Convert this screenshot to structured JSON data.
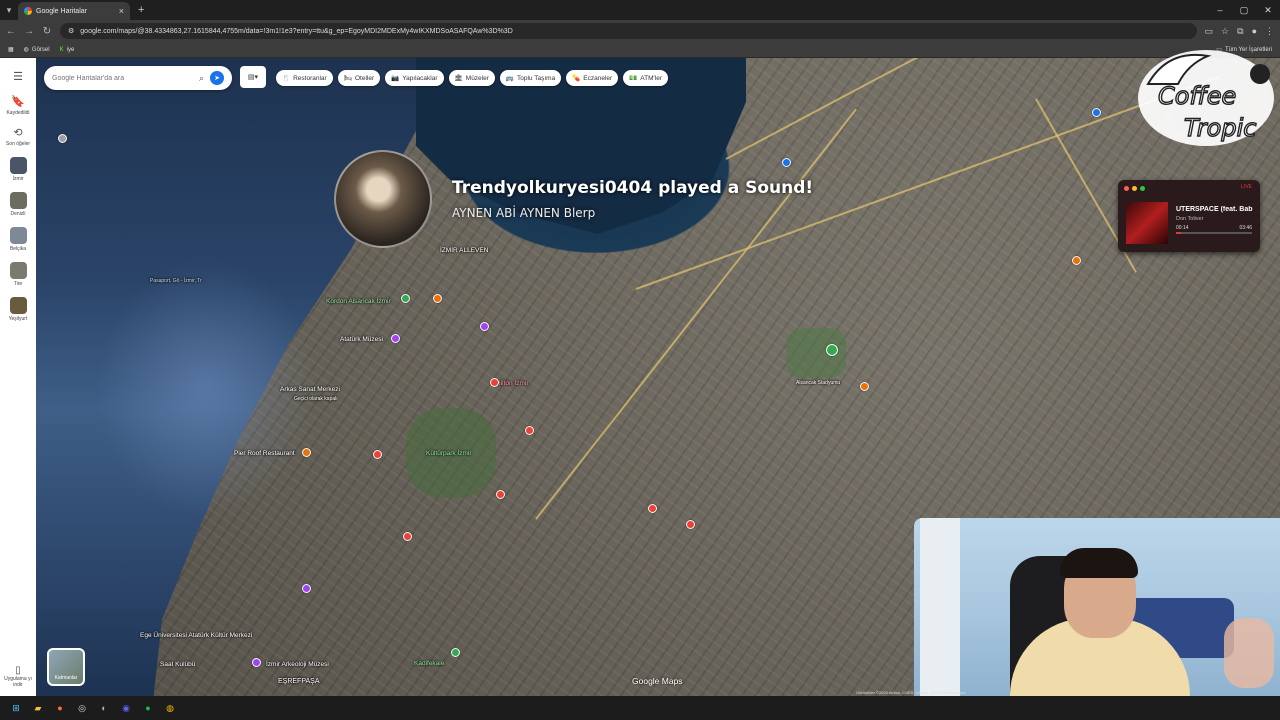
{
  "browser": {
    "tab_title": "Google Haritalar",
    "tab_close": "×",
    "new_tab": "+",
    "url": "google.com/maps/@38.4334863,27.1615844,4755m/data=!3m1!1e3?entry=ttu&g_ep=EgoyMDI2MDExMy4wIKXMDSoASAFQAw%3D%3D",
    "bookmarks": [
      {
        "label": "Görsel"
      },
      {
        "label": "iye"
      }
    ],
    "bookmarks_right": "Tüm Yer İşaretleri"
  },
  "rail": {
    "menu": "☰",
    "items": [
      {
        "label": "Kaydedildi",
        "icon": "bookmark-icon"
      },
      {
        "label": "Son öğeler",
        "icon": "history-icon"
      },
      {
        "label": "İzmir",
        "icon": "place-thumb"
      },
      {
        "label": "Denizli",
        "icon": "place-thumb"
      },
      {
        "label": "Belçika",
        "icon": "place-thumb"
      },
      {
        "label": "Tire",
        "icon": "place-thumb"
      },
      {
        "label": "Yeşilyurt",
        "icon": "place-thumb"
      }
    ],
    "bottom": "Uygulama yı indir"
  },
  "search": {
    "placeholder": "Google Haritalar'da ara"
  },
  "chips": [
    {
      "label": "Restoranlar",
      "icon": "🍴"
    },
    {
      "label": "Oteller",
      "icon": "🛏"
    },
    {
      "label": "Yapılacaklar",
      "icon": "📷"
    },
    {
      "label": "Müzeler",
      "icon": "🏛"
    },
    {
      "label": "Toplu Taşıma",
      "icon": "🚌"
    },
    {
      "label": "Eczaneler",
      "icon": "💊"
    },
    {
      "label": "ATM'ler",
      "icon": "💵"
    }
  ],
  "notification": {
    "title": "Trendyolkuryesi0404 played a Sound!",
    "subtitle": "AYNEN ABİ AYNEN Blerp"
  },
  "logo": {
    "line1": "Coffee",
    "line2": "Tropic"
  },
  "player": {
    "title": "UTERSPACE (feat. Bab",
    "artist": "Don Toliver",
    "elapsed": "00:14",
    "duration": "03:46",
    "progress": 0.06,
    "live": "LIVE"
  },
  "map_labels": [
    {
      "text": "İZMİR ALLEVEN"
    },
    {
      "text": "Kordon Alsancak İzmir"
    },
    {
      "text": "Atatürk Müzesi"
    },
    {
      "text": "Arkas Sanat Merkezi"
    },
    {
      "text": "Geçici olarak kapalı"
    },
    {
      "text": "Pier Roof Restaurant"
    },
    {
      "text": "Kültürpark İzmir"
    },
    {
      "text": "Hilton İzmir"
    },
    {
      "text": "Ege Üniversitesi Atatürk Kültür Merkezi"
    },
    {
      "text": "Saat Kulübü"
    },
    {
      "text": "İzmir Arkeoloji Müzesi"
    },
    {
      "text": "Kadifekale"
    },
    {
      "text": "EŞREFPAŞA"
    },
    {
      "text": "Pasaport, Gö - İzmir, Tr"
    },
    {
      "text": "Alsancak Stadyumu"
    }
  ],
  "layers_label": "Katmanlar",
  "google_maps": "Google Maps",
  "attribution": "Görüntüler ©2026 Airbus, CNES / Airbus, Maxar Technologies"
}
